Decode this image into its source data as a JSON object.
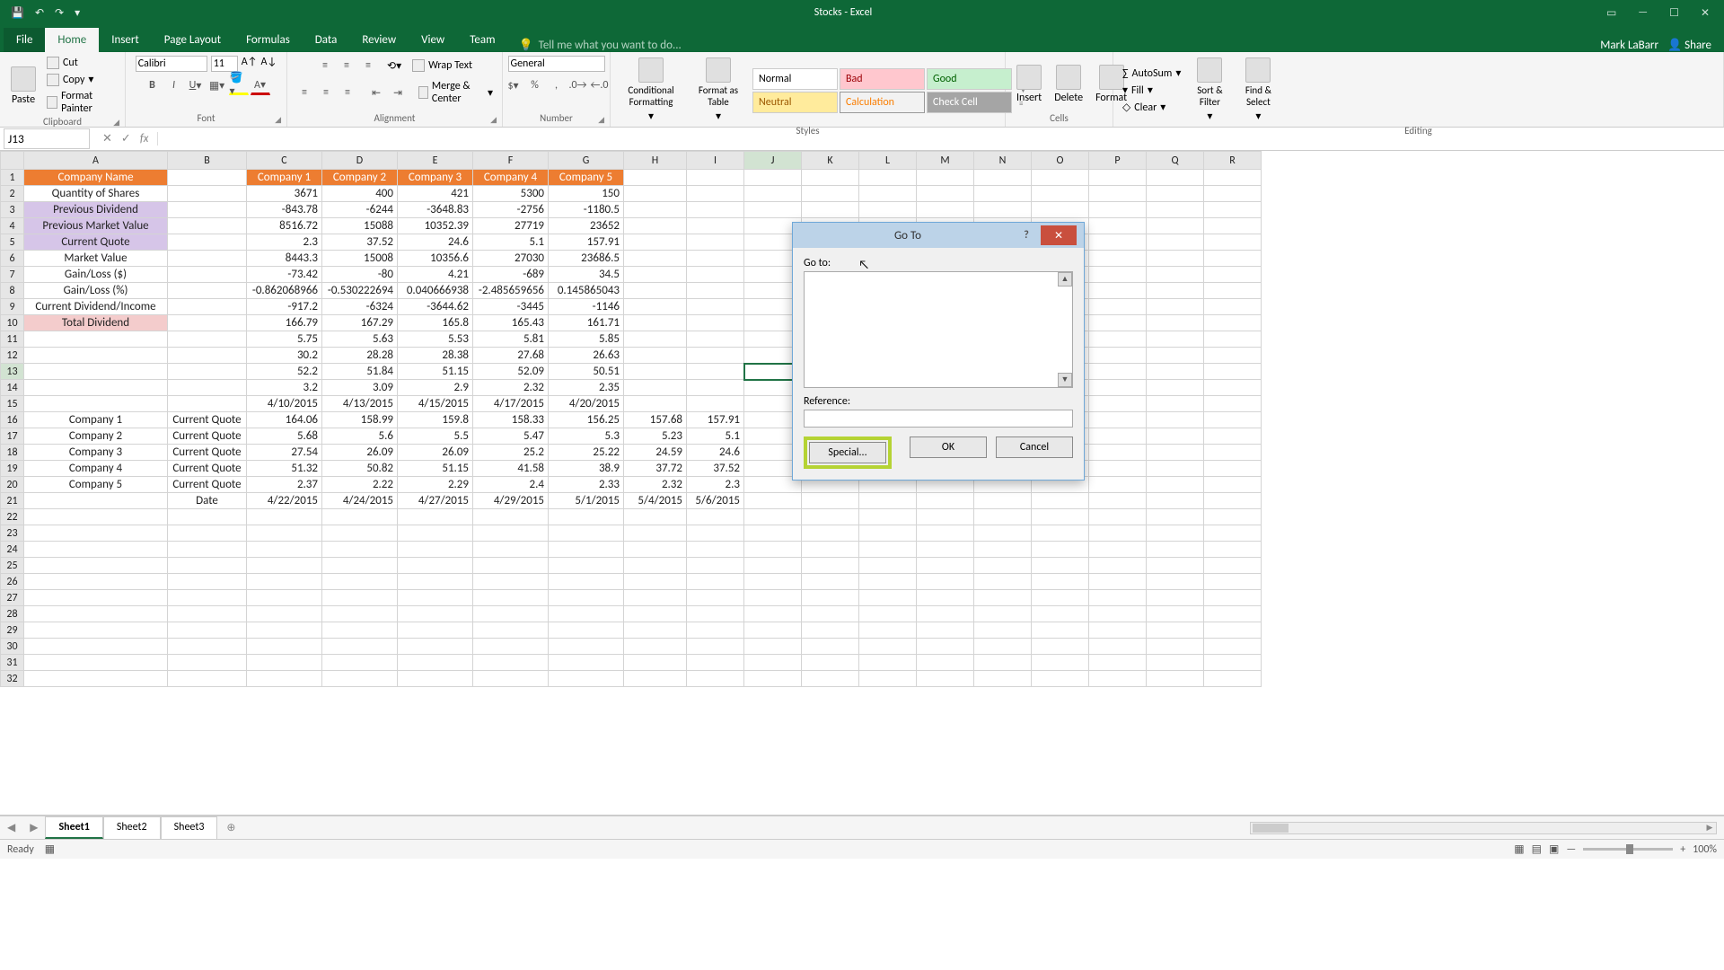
{
  "app": {
    "title": "Stocks - Excel",
    "user": "Mark LaBarr",
    "share": "Share"
  },
  "tabs": [
    "File",
    "Home",
    "Insert",
    "Page Layout",
    "Formulas",
    "Data",
    "Review",
    "View",
    "Team"
  ],
  "tell_me": "Tell me what you want to do...",
  "ribbon": {
    "clipboard": {
      "label": "Clipboard",
      "paste": "Paste",
      "cut": "Cut",
      "copy": "Copy",
      "painter": "Format Painter"
    },
    "font": {
      "label": "Font",
      "name": "Calibri",
      "size": "11"
    },
    "alignment": {
      "label": "Alignment",
      "wrap": "Wrap Text",
      "merge": "Merge & Center"
    },
    "number": {
      "label": "Number",
      "format": "General"
    },
    "styles": {
      "label": "Styles",
      "cond": "Conditional Formatting",
      "fat": "Format as Table",
      "gallery": [
        "Normal",
        "Bad",
        "Good",
        "Neutral",
        "Calculation",
        "Check Cell"
      ]
    },
    "cells": {
      "label": "Cells",
      "insert": "Insert",
      "delete": "Delete",
      "format": "Format"
    },
    "editing": {
      "label": "Editing",
      "autosum": "AutoSum",
      "fill": "Fill",
      "clear": "Clear",
      "sort": "Sort & Filter",
      "find": "Find & Select"
    }
  },
  "namebox": "J13",
  "columns": [
    "A",
    "B",
    "C",
    "D",
    "E",
    "F",
    "G",
    "H",
    "I",
    "J",
    "K",
    "L",
    "M",
    "N",
    "O",
    "P",
    "Q",
    "R"
  ],
  "rowcount": 32,
  "cells": {
    "A1": "Company Name",
    "C1": "Company 1",
    "D1": "Company 2",
    "E1": "Company 3",
    "F1": "Company 4",
    "G1": "Company 5",
    "A2": "Quantity of Shares",
    "C2": "3671",
    "D2": "400",
    "E2": "421",
    "F2": "5300",
    "G2": "150",
    "A3": "Previous Dividend",
    "C3": "-843.78",
    "D3": "-6244",
    "E3": "-3648.83",
    "F3": "-2756",
    "G3": "-1180.5",
    "A4": "Previous Market Value",
    "C4": "8516.72",
    "D4": "15088",
    "E4": "10352.39",
    "F4": "27719",
    "G4": "23652",
    "A5": "Current Quote",
    "C5": "2.3",
    "D5": "37.52",
    "E5": "24.6",
    "F5": "5.1",
    "G5": "157.91",
    "A6": "Market Value",
    "C6": "8443.3",
    "D6": "15008",
    "E6": "10356.6",
    "F6": "27030",
    "G6": "23686.5",
    "A7": "Gain/Loss ($)",
    "C7": "-73.42",
    "D7": "-80",
    "E7": "4.21",
    "F7": "-689",
    "G7": "34.5",
    "A8": "Gain/Loss (%)",
    "C8": "-0.862068966",
    "D8": "-0.530222694",
    "E8": "0.040666938",
    "F8": "-2.485659656",
    "G8": "0.145865043",
    "A9": "Current Dividend/Income",
    "C9": "-917.2",
    "D9": "-6324",
    "E9": "-3644.62",
    "F9": "-3445",
    "G9": "-1146",
    "A10": "Total Dividend",
    "C10": "166.79",
    "D10": "167.29",
    "E10": "165.8",
    "F10": "165.43",
    "G10": "161.71",
    "C11": "5.75",
    "D11": "5.63",
    "E11": "5.53",
    "F11": "5.81",
    "G11": "5.85",
    "C12": "30.2",
    "D12": "28.28",
    "E12": "28.38",
    "F12": "27.68",
    "G12": "26.63",
    "C13": "52.2",
    "D13": "51.84",
    "E13": "51.15",
    "F13": "52.09",
    "G13": "50.51",
    "C14": "3.2",
    "D14": "3.09",
    "E14": "2.9",
    "F14": "2.32",
    "G14": "2.35",
    "C15": "4/10/2015",
    "D15": "4/13/2015",
    "E15": "4/15/2015",
    "F15": "4/17/2015",
    "G15": "4/20/2015",
    "A16": "Company 1",
    "B16": "Current Quote",
    "C16": "164.06",
    "D16": "158.99",
    "E16": "159.8",
    "F16": "158.33",
    "G16": "156.25",
    "H16": "157.68",
    "I16": "157.91",
    "A17": "Company 2",
    "B17": "Current Quote",
    "C17": "5.68",
    "D17": "5.6",
    "E17": "5.5",
    "F17": "5.47",
    "G17": "5.3",
    "H17": "5.23",
    "I17": "5.1",
    "A18": "Company 3",
    "B18": "Current Quote",
    "C18": "27.54",
    "D18": "26.09",
    "E18": "26.09",
    "F18": "25.2",
    "G18": "25.22",
    "H18": "24.59",
    "I18": "24.6",
    "A19": "Company 4",
    "B19": "Current Quote",
    "C19": "51.32",
    "D19": "50.82",
    "E19": "51.15",
    "F19": "41.58",
    "G19": "38.9",
    "H19": "37.72",
    "I19": "37.52",
    "A20": "Company 5",
    "B20": "Current Quote",
    "C20": "2.37",
    "D20": "2.22",
    "E20": "2.29",
    "F20": "2.4",
    "G20": "2.33",
    "H20": "2.32",
    "I20": "2.3",
    "B21": "Date",
    "C21": "4/22/2015",
    "D21": "4/24/2015",
    "E21": "4/27/2015",
    "F21": "4/29/2015",
    "G21": "5/1/2015",
    "H21": "5/4/2015",
    "I21": "5/6/2015"
  },
  "cellstyle": {
    "A1": "hdr-orange",
    "C1": "hdr-orange",
    "D1": "hdr-orange",
    "E1": "hdr-orange",
    "F1": "hdr-orange",
    "G1": "hdr-orange",
    "A3": "hdr-purple",
    "A4": "hdr-purple",
    "A5": "hdr-purple",
    "A10": "hdr-pink"
  },
  "sheets": [
    "Sheet1",
    "Sheet2",
    "Sheet3"
  ],
  "status": {
    "ready": "Ready",
    "zoom": "100%"
  },
  "dialog": {
    "title": "Go To",
    "goto_label": "Go to:",
    "ref_label": "Reference:",
    "special": "Special...",
    "ok": "OK",
    "cancel": "Cancel"
  }
}
